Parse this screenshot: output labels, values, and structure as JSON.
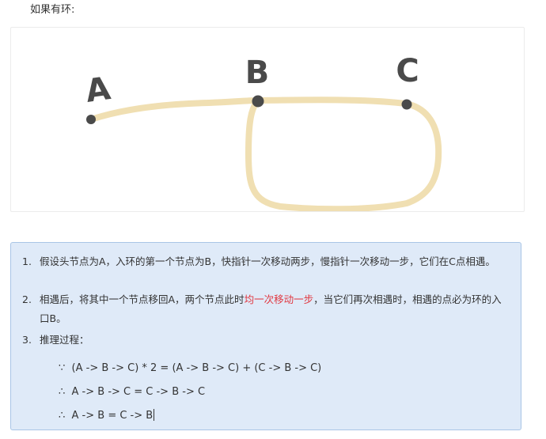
{
  "intro_text": "如果有环:",
  "diagram": {
    "labels": {
      "a": "A",
      "b": "B",
      "c": "C"
    },
    "path_color": "#f0dfb2",
    "node_color": "#4a4a4a"
  },
  "note": {
    "steps": [
      {
        "num": "1.",
        "text": "假设头节点为A，入环的第一个节点为B，快指针一次移动两步，慢指针一次移动一步，它们在C点相遇。"
      },
      {
        "num": "2.",
        "text_before": "相遇后，将其中一个节点移回A，两个节点此时",
        "highlight": "均一次移动一步",
        "text_after": "，当它们再次相遇时，相遇的点必为环的入口B。"
      },
      {
        "num": "3.",
        "text": "推理过程："
      }
    ],
    "formulas": [
      "∵  (A -> B -> C) * 2 = (A -> B -> C) + (C -> B -> C)",
      "∴  A -> B -> C = C -> B -> C",
      "∴  A -> B = C -> B"
    ],
    "highlight_color": "#e0363f"
  }
}
